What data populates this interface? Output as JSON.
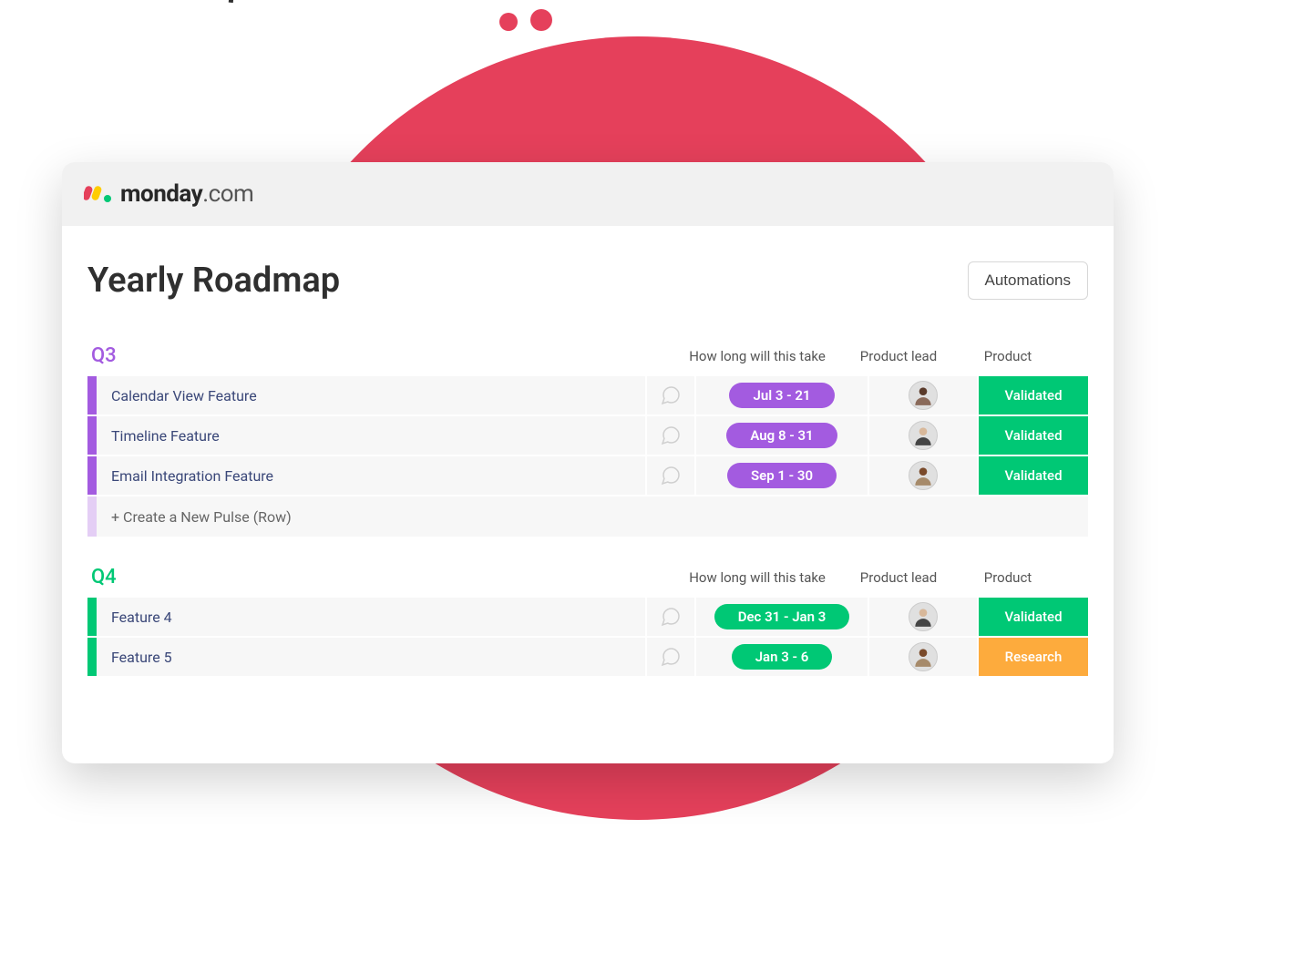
{
  "brand": {
    "name_bold": "monday",
    "name_light": ".com"
  },
  "page": {
    "title": "Yearly Roadmap",
    "automations_label": "Automations"
  },
  "columns": {
    "duration": "How long will this take",
    "lead": "Product lead",
    "product": "Product"
  },
  "groups": [
    {
      "id": "q3",
      "title": "Q3",
      "color": "purple",
      "rows": [
        {
          "name": "Calendar View Feature",
          "duration": "Jul 3 - 21",
          "lead": "person-1",
          "product": "Validated",
          "product_status": "validated"
        },
        {
          "name": "Timeline Feature",
          "duration": "Aug 8 - 31",
          "lead": "person-2",
          "product": "Validated",
          "product_status": "validated"
        },
        {
          "name": "Email Integration Feature",
          "duration": "Sep 1 - 30",
          "lead": "person-3",
          "product": "Validated",
          "product_status": "validated"
        }
      ],
      "new_row_label": "+ Create a New Pulse (Row)"
    },
    {
      "id": "q4",
      "title": "Q4",
      "color": "green",
      "rows": [
        {
          "name": "Feature 4",
          "duration": "Dec 31 - Jan 3",
          "lead": "person-2",
          "product": "Validated",
          "product_status": "validated"
        },
        {
          "name": "Feature 5",
          "duration": "Jan 3 - 6",
          "lead": "person-3",
          "product": "Research",
          "product_status": "research"
        }
      ]
    }
  ],
  "colors": {
    "purple": "#a35be0",
    "green": "#00c875",
    "orange": "#fdab3d",
    "red": "#e5405b"
  }
}
